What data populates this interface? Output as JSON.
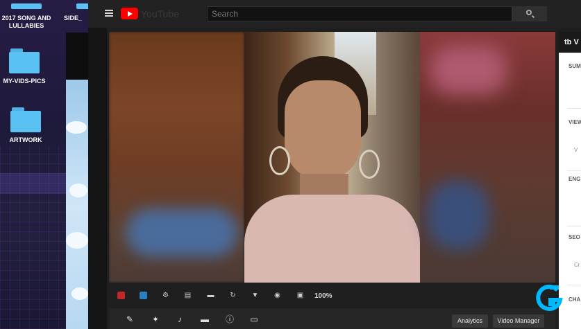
{
  "desktop": {
    "icons": [
      {
        "label": "2017 SONG AND LULLABIES",
        "icon": "folder-icon"
      },
      {
        "label": "SIDE_",
        "icon": "folder-icon"
      },
      {
        "label": "MY-VIDS-PICS",
        "icon": "folder-icon"
      },
      {
        "label": "ARTWORK",
        "icon": "folder-icon"
      }
    ]
  },
  "youtube": {
    "logo_text": "YouTube",
    "search_placeholder": "Search",
    "brand_color": "#ff0000",
    "editor_toolbar": {
      "icons": [
        "red-square-icon",
        "blue-square-icon",
        "gear-icon",
        "filmstrip-icon",
        "caption-icon",
        "rotate-icon",
        "filter-icon",
        "blur-icon",
        "camera-icon"
      ],
      "zoom": "100%"
    },
    "bottom_toolbar": {
      "icons": [
        "pencil-icon",
        "magic-wand-icon",
        "music-note-icon",
        "card-icon",
        "info-icon",
        "subtitles-icon"
      ],
      "analytics_label": "Analytics",
      "video_manager_label": "Video Manager"
    }
  },
  "side_panel": {
    "header": "tb V",
    "labels": [
      "SUM",
      "VIEW",
      "ENG",
      "SEO",
      "CHA"
    ],
    "sub_labels": [
      "V",
      "Cr"
    ]
  },
  "overlay": {
    "logo": "logitech-g-icon",
    "logo_color": "#00b8fc"
  }
}
